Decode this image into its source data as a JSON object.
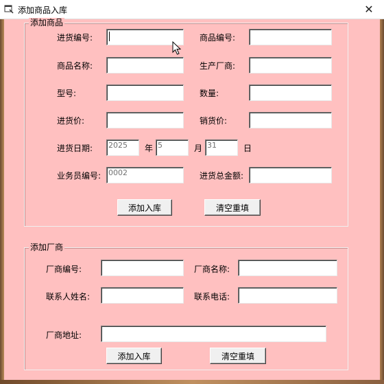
{
  "window": {
    "title": "添加商品入库",
    "close_glyph": "✕"
  },
  "goods_group": {
    "title": "添加商品",
    "purchase_no_label": "进货编号:",
    "product_no_label": "商品编号:",
    "product_name_label": "商品名称:",
    "manufacturer_label": "生产厂商:",
    "model_label": "型号:",
    "quantity_label": "数量:",
    "purchase_price_label": "进货价:",
    "sale_price_label": "销货价:",
    "purchase_date_label": "进货日期:",
    "year_value": "2025",
    "year_unit": "年",
    "month_value": "5",
    "month_unit": "月",
    "day_value": "31",
    "day_unit": "日",
    "clerk_no_label": "业务员编号:",
    "clerk_no_value": "0002",
    "total_amount_label": "进货总金额:",
    "add_button": "添加入库",
    "reset_button": "清空重填"
  },
  "vendor_group": {
    "title": "添加厂商",
    "vendor_no_label": "厂商编号:",
    "vendor_name_label": "厂商名称:",
    "contact_name_label": "联系人姓名:",
    "contact_phone_label": "联系电话:",
    "address_label": "厂商地址:",
    "add_button": "添加入库",
    "reset_button": "清空重填"
  },
  "colors": {
    "form_background": "#ffc0c0",
    "titlebar_background": "#ffffff"
  }
}
